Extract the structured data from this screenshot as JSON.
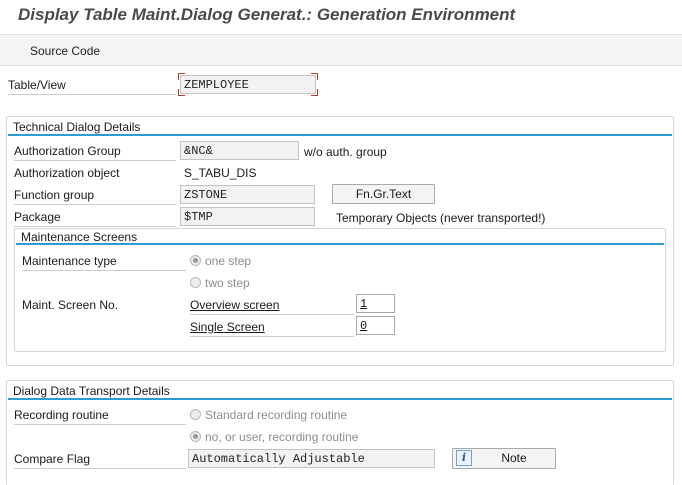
{
  "window": {
    "title": "Display Table Maint.Dialog Generat.: Generation Environment"
  },
  "toolbar": {
    "source_code_label": "Source Code"
  },
  "table_view": {
    "label": "Table/View",
    "value": "ZEMPLOYEE"
  },
  "technical": {
    "title": "Technical Dialog Details",
    "auth_group_label": "Authorization Group",
    "auth_group_value": "&NC&",
    "auth_group_note": "w/o auth. group",
    "auth_object_label": "Authorization object",
    "auth_object_value": "S_TABU_DIS",
    "function_group_label": "Function group",
    "function_group_value": "ZSTONE",
    "fngr_button_label": "Fn.Gr.Text",
    "package_label": "Package",
    "package_value": "$TMP",
    "package_note": "Temporary Objects (never transported!)"
  },
  "maintenance": {
    "title": "Maintenance Screens",
    "type_label": "Maintenance type",
    "one_step_label": "one step",
    "two_step_label": "two step",
    "selected": "one step",
    "screen_no_label": "Maint. Screen No.",
    "overview_label": "Overview screen",
    "overview_value": "1",
    "single_label": "Single Screen",
    "single_value": "0"
  },
  "transport": {
    "title": "Dialog Data Transport Details",
    "recording_label": "Recording routine",
    "standard_label": "Standard recording routine",
    "no_user_label": "no, or user, recording routine",
    "selected": "no, or user, recording routine",
    "compare_label": "Compare Flag",
    "compare_value": "Automatically Adjustable",
    "note_button_label": "Note",
    "info_icon_glyph": "i"
  },
  "colors": {
    "accent_line": "#2e9bd6",
    "focus_marker": "#c0392b",
    "title_text": "#4a4a4a"
  }
}
